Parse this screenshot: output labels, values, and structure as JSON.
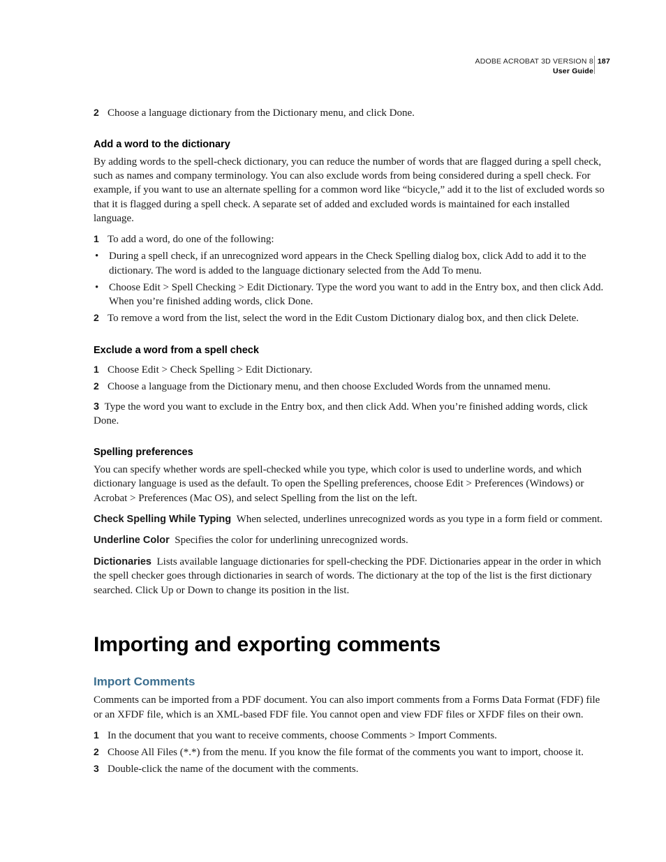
{
  "header": {
    "product": "ADOBE ACROBAT 3D VERSION 8",
    "pagenum": "187",
    "guide": "User Guide"
  },
  "step_lang_dict": {
    "num": "2",
    "text": "Choose a language dictionary from the Dictionary menu, and click Done."
  },
  "add_word": {
    "heading": "Add a word to the dictionary",
    "intro": "By adding words to the spell-check dictionary, you can reduce the number of words that are flagged during a spell check, such as names and company terminology. You can also exclude words from being considered during a spell check. For example, if you want to use an alternate spelling for a common word like “bicycle,” add it to the list of excluded words so that it is flagged during a spell check. A separate set of added and excluded words is maintained for each installed language.",
    "step1_num": "1",
    "step1_text": "To add a word, do one of the following:",
    "bullet1": "During a spell check, if an unrecognized word appears in the Check Spelling dialog box, click Add to add it to the dictionary. The word is added to the language dictionary selected from the Add To menu.",
    "bullet2": "Choose Edit > Spell Checking > Edit Dictionary. Type the word you want to add in the Entry box, and then click Add. When you’re finished adding words, click Done.",
    "step2_num": "2",
    "step2_text": "To remove a word from the list, select the word in the Edit Custom Dictionary dialog box, and then click Delete."
  },
  "exclude_word": {
    "heading": "Exclude a word from a spell check",
    "step1_num": "1",
    "step1_text": "Choose Edit > Check Spelling > Edit Dictionary.",
    "step2_num": "2",
    "step2_text": "Choose a language from the Dictionary menu, and then choose Excluded Words from the unnamed menu.",
    "step3_num": "3",
    "step3_text": "Type the word you want to exclude in the Entry box, and then click Add. When you’re finished adding words, click Done."
  },
  "spelling_prefs": {
    "heading": "Spelling preferences",
    "intro": "You can specify whether words are spell-checked while you type, which color is used to underline words, and which dictionary language is used as the default. To open the Spelling preferences, choose Edit > Preferences (Windows) or Acrobat > Preferences (Mac OS), and select Spelling from the list on the left.",
    "term1": "Check Spelling While Typing",
    "def1": "When selected, underlines unrecognized words as you type in a form field or comment.",
    "term2": "Underline Color",
    "def2": "Specifies the color for underlining unrecognized words.",
    "term3": "Dictionaries",
    "def3": "Lists available language dictionaries for spell-checking the PDF. Dictionaries appear in the order in which the spell checker goes through dictionaries in search of words. The dictionary at the top of the list is the first dictionary searched. Click Up or Down to change its position in the list."
  },
  "import_export": {
    "h1": "Importing and exporting comments",
    "h2": "Import Comments",
    "intro": "Comments can be imported from a PDF document. You can also import comments from a Forms Data Format (FDF) file or an XFDF file, which is an XML-based FDF file. You cannot open and view FDF files or XFDF files on their own.",
    "step1_num": "1",
    "step1_text": "In the document that you want to receive comments, choose Comments > Import Comments.",
    "step2_num": "2",
    "step2_text": "Choose All Files (*.*) from the menu. If you know the file format of the comments you want to import, choose it.",
    "step3_num": "3",
    "step3_text": "Double-click the name of the document with the comments."
  }
}
